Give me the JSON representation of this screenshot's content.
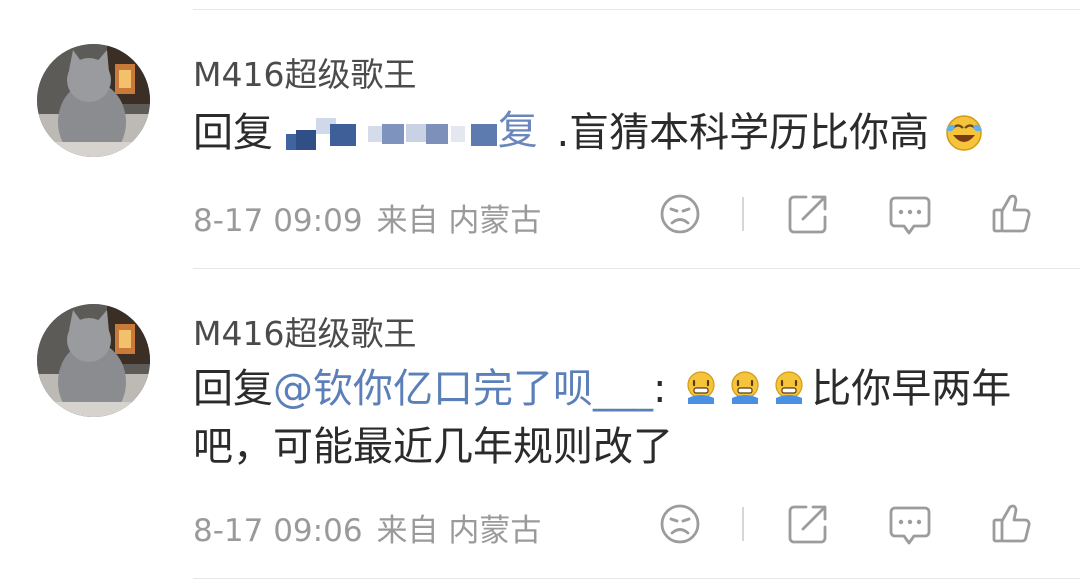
{
  "comments": [
    {
      "username": "M416超级歌王",
      "reply_prefix": "回复",
      "redacted_tail": "复",
      "text": ".盲猜本科学历比你高",
      "emoji": "laugh-cry-emoji",
      "date": "8-17 09:09",
      "source": "来自 内蒙古"
    },
    {
      "username": "M416超级歌王",
      "reply_prefix": "回复",
      "mention": "@钦你亿口完了呗___",
      "colon": ":",
      "emojis": [
        "bling-emoji",
        "bling-emoji",
        "bling-emoji"
      ],
      "text": "比你早两年吧，可能最近几年规则改了",
      "date": "8-17 09:06",
      "source": "来自 内蒙古"
    }
  ],
  "icons": [
    "dislike-face-icon",
    "share-icon",
    "comment-icon",
    "like-thumb-icon"
  ],
  "colors": {
    "mention": "#5b7fb8",
    "text": "#2b2b2b",
    "muted": "#9a9a9a",
    "icon": "#9c9c9c"
  }
}
